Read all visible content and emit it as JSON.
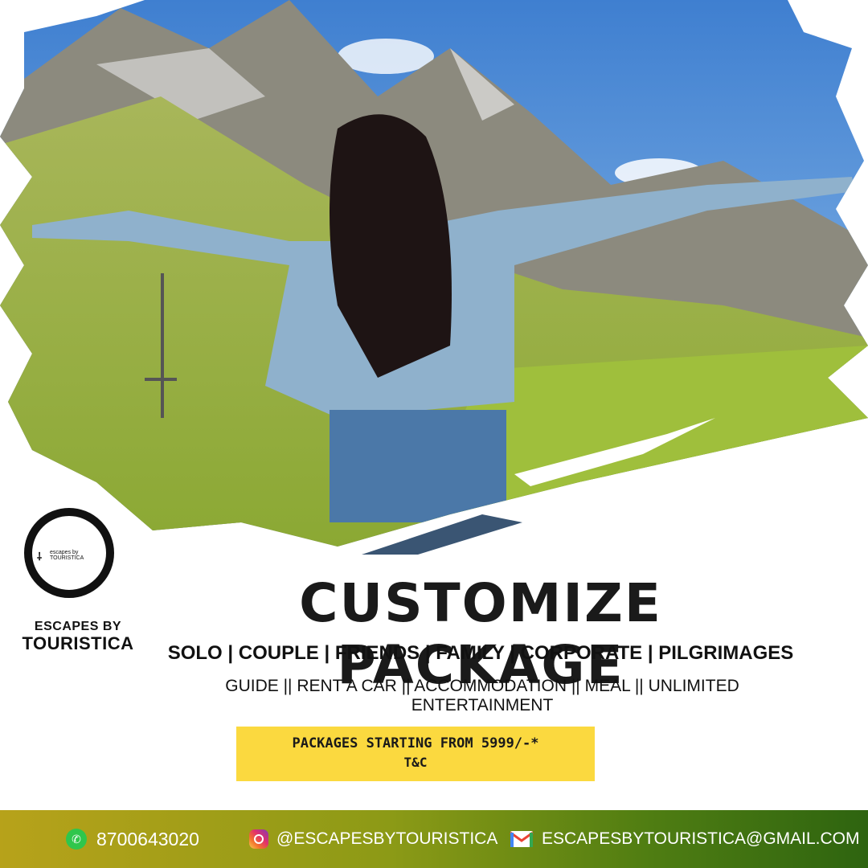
{
  "brand": {
    "logo_text_small": "escapes by",
    "logo_text_small2": "TOURISTICA",
    "name_top": "ESCAPES BY",
    "name_bottom": "TOURISTICA"
  },
  "headline": "CUSTOMIZE PACKAGE",
  "traveler_types": "SOLO |  COUPLE | FRIENDS | FAMILY | CORPORATE | PILGRIMAGES",
  "services": "GUIDE || RENT A CAR || ACCOMMODATION || MEAL || UNLIMITED ENTERTAINMENT",
  "price": {
    "line": "PACKAGES STARTING FROM 5999/-*",
    "terms": "T&C",
    "bg_color": "#fbd93f"
  },
  "contact": {
    "phone": "8700643020",
    "instagram": "@ESCAPESBYTOURISTICA",
    "email": "ESCAPESBYTOURISTICA@GMAIL.COM"
  },
  "icons": {
    "phone": "whatsapp-icon",
    "instagram": "instagram-icon",
    "email": "gmail-icon"
  }
}
